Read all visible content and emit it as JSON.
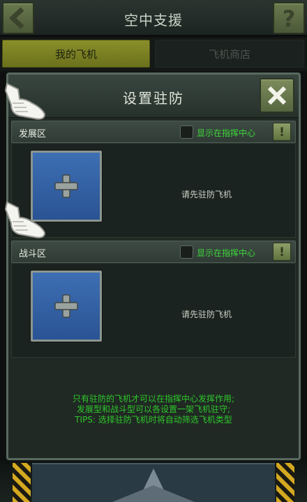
{
  "header": {
    "title": "空中支援"
  },
  "tabs": [
    {
      "label": "我的飞机",
      "active": true
    },
    {
      "label": "飞机商店",
      "active": false
    }
  ],
  "modal": {
    "title": "设置驻防",
    "sections": [
      {
        "label": "发展区",
        "checkbox_label": "显示在指挥中心",
        "checked": false,
        "info": "!",
        "empty_text": "请先驻防飞机"
      },
      {
        "label": "战斗区",
        "checkbox_label": "显示在指挥中心",
        "checked": false,
        "info": "!",
        "empty_text": "请先驻防飞机"
      }
    ],
    "tips": [
      "只有驻防的飞机才可以在指挥中心发挥作用;",
      "发展型和战斗型可以各设置一架飞机驻守;",
      "TIPS: 选择驻防飞机时将自动筛选飞机类型"
    ]
  },
  "colors": {
    "accent_green": "#3ed83a",
    "tab_active": "#8a8f2a",
    "slot_blue": "#3d6fb3"
  }
}
